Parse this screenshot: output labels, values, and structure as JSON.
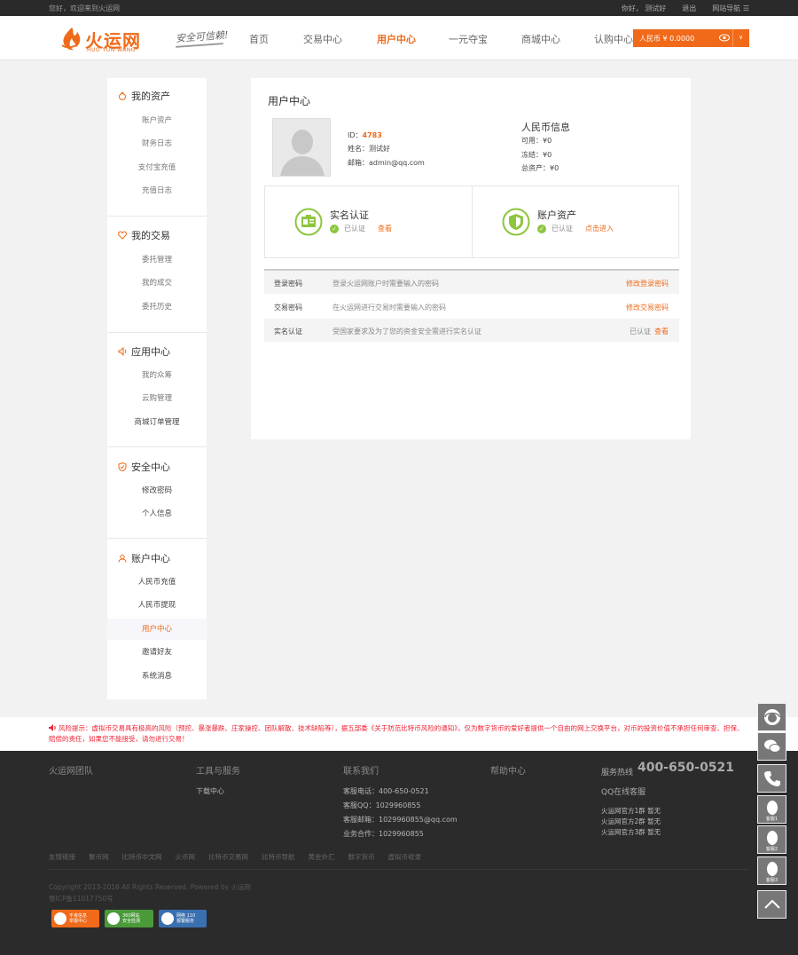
{
  "topbar": {
    "welcome": "您好，欢迎来到火运网",
    "greeting": "你好， 测试好",
    "logout": "退出",
    "site_nav": "网站导航 ☰"
  },
  "header": {
    "logo_text": "火运网",
    "logo_pinyin": "HUO YUN WANG",
    "slogan": "安全可信赖!",
    "nav": [
      "首页",
      "交易中心",
      "用户中心",
      "一元夺宝",
      "商城中心",
      "认购中心"
    ],
    "active_nav": "用户中心",
    "rmb_balance": "人民币 ¥ 0.0000"
  },
  "sidebar": {
    "groups": [
      {
        "title": "我的资产",
        "icon": "money-bag-icon",
        "items": [
          "账户资产",
          "财务日志",
          "支付宝充值",
          "充值日志"
        ]
      },
      {
        "title": "我的交易",
        "icon": "heart-icon",
        "items": [
          "委托管理",
          "我的成交",
          "委托历史"
        ]
      },
      {
        "title": "应用中心",
        "icon": "speaker-icon",
        "items": [
          "我的众筹",
          "云购管理",
          "商城订单管理"
        ]
      },
      {
        "title": "安全中心",
        "icon": "shield-icon",
        "items": [
          "修改密码",
          "个人信息"
        ]
      },
      {
        "title": "账户中心",
        "icon": "user-icon",
        "items": [
          "人民币充值",
          "人民币提现",
          "用户中心",
          "邀请好友",
          "系统消息"
        ]
      }
    ],
    "active_item": "用户中心"
  },
  "main": {
    "title": "用户中心",
    "user": {
      "id_label": "ID：",
      "id": "4783",
      "name": "姓名：测试好",
      "email": "邮箱：admin@qq.com"
    },
    "rmb_info": {
      "title": "人民币信息",
      "available": "可用：¥0",
      "frozen": "冻结：¥0",
      "total": "总资产：¥0"
    },
    "certs": [
      {
        "title": "实名认证",
        "status": "已认证",
        "link": "查看",
        "icon": "id-card-icon"
      },
      {
        "title": "账户资产",
        "status": "已认证",
        "link": "点击进入",
        "icon": "shield-icon"
      }
    ],
    "security": [
      {
        "key": "登录密码",
        "desc": "登录火运网账户时需要输入的密码",
        "action": "修改登录密码"
      },
      {
        "key": "交易密码",
        "desc": "在火运网进行交易时需要输入的密码",
        "action": "修改交易密码"
      },
      {
        "key": "实名认证",
        "desc": "受国家要求及为了您的资金安全需进行实名认证",
        "status": "已认证",
        "action": "查看"
      }
    ]
  },
  "risk_notice": "风险提示：虚拟币交易具有极高的风险（预挖、暴涨暴跌、庄家操控、团队解散、技术缺陷等），据五部委《关于防范比特币风险的通知》，仅为数字货币的爱好者提供一个自由的网上交换平台，对币的投资价值不承担任何审查、担保、赔偿的责任，如果您不能接受，请勿进行交易！",
  "footer": {
    "col_titles": [
      "火运网团队",
      "工具与服务",
      "联系我们",
      "帮助中心"
    ],
    "tools": [
      "下载中心"
    ],
    "contact": [
      "客服电话：400-650-0521",
      "客服QQ：1029960855",
      "客服邮箱：1029960855@qq.com",
      "业务合作：1029960855"
    ],
    "hotline_label": "服务热线",
    "hotline": "400-650-0521",
    "qq_title": "QQ在线客服",
    "qq_groups": [
      "火运网官方1群 暂无",
      "火运网官方2群 暂无",
      "火运网官方3群 暂无"
    ],
    "links": [
      "友情链接",
      "聚币网",
      "比特币中文网",
      "火币网",
      "比特币交易网",
      "比特币导航",
      "黄金外汇",
      "数字货币",
      "虚拟币收录"
    ],
    "copyright": "Copyright 2013-2016 All Rights Reserved. Powered by 火运网",
    "icp": "蜀ICP备11017750号",
    "badges": [
      {
        "line1": "不良信息",
        "line2": "举报中心",
        "color": "#f06a1a"
      },
      {
        "line1": "360网站",
        "line2": "安全检测",
        "color": "#4a9a3a"
      },
      {
        "line1": "网络 110",
        "line2": "报警服务",
        "color": "#3a6fb0"
      }
    ]
  },
  "tools": {
    "kefu1": "客服1",
    "kefu2": "客服2",
    "kefu3": "客服3"
  }
}
